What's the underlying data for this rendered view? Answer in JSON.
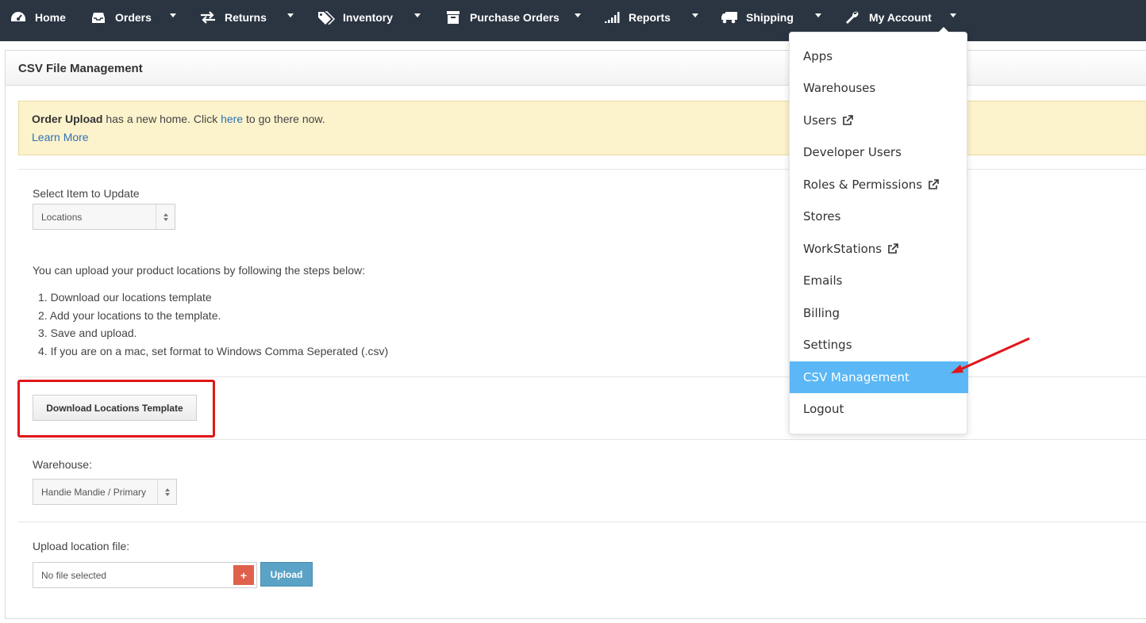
{
  "nav": {
    "items": [
      {
        "label": "Home",
        "icon": "dashboard-icon"
      },
      {
        "label": "Orders",
        "icon": "inbox-icon"
      },
      {
        "label": "Returns",
        "icon": "exchange-icon"
      },
      {
        "label": "Inventory",
        "icon": "tags-icon"
      },
      {
        "label": "Purchase Orders",
        "icon": "archive-icon"
      },
      {
        "label": "Reports",
        "icon": "signal-icon"
      },
      {
        "label": "Shipping",
        "icon": "truck-icon"
      },
      {
        "label": "My Account",
        "icon": "wrench-icon"
      }
    ]
  },
  "page": {
    "title": "CSV File Management"
  },
  "alert": {
    "bold": "Order Upload",
    "text_before_link": " has a new home. Click ",
    "link": "here",
    "text_after_link": " to go there now.",
    "learn_more": "Learn More",
    "background": "#fcf3cd"
  },
  "form": {
    "select_item_label": "Select Item to Update",
    "select_item_value": "Locations",
    "intro": "You can upload your product locations by following the steps below:",
    "steps": [
      "1. Download our locations template",
      "2. Add your locations to the template.",
      "3. Save and upload.",
      "4. If you are on a mac, set format to Windows Comma Seperated (.csv)"
    ],
    "download_button": "Download Locations Template",
    "warehouse_label": "Warehouse:",
    "warehouse_value": "Handie Mandie / Primary",
    "upload_label": "Upload location file:",
    "file_placeholder": "No file selected",
    "add_file_symbol": "+",
    "upload_button": "Upload"
  },
  "dropdown": {
    "items": [
      {
        "label": "Apps"
      },
      {
        "label": "Warehouses"
      },
      {
        "label": "Users",
        "external": true
      },
      {
        "label": "Developer Users"
      },
      {
        "label": "Roles & Permissions",
        "external": true
      },
      {
        "label": "Stores"
      },
      {
        "label": "WorkStations",
        "external": true
      },
      {
        "label": "Emails"
      },
      {
        "label": "Billing"
      },
      {
        "label": "Settings"
      },
      {
        "label": "CSV Management",
        "active": true
      },
      {
        "label": "Logout"
      }
    ],
    "active_color": "#5bb7f5"
  },
  "colors": {
    "navbar": "#2b3542",
    "highlight": "#e0161a",
    "upload_button": "#5aa3c6",
    "add_button": "#e0614b"
  }
}
